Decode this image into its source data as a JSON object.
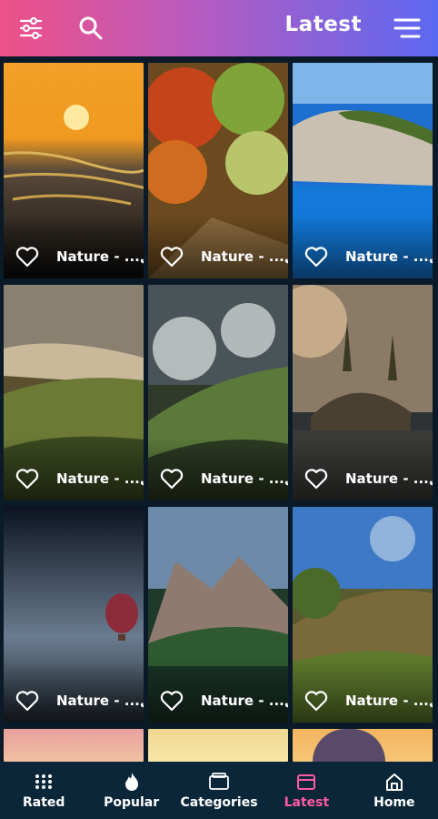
{
  "topbar": {
    "title": "Latest",
    "icons": [
      "filter-sliders-icon",
      "search-icon",
      "hamburger-menu-icon"
    ]
  },
  "wallpapers": [
    {
      "label": "Nature - ...ل",
      "scene": "sunset-river"
    },
    {
      "label": "Nature - ...ل",
      "scene": "autumn-forest"
    },
    {
      "label": "Nature - ...ل",
      "scene": "coastal-cliff"
    },
    {
      "label": "Nature - ...ل",
      "scene": "hill-valley"
    },
    {
      "label": "Nature - ...ل",
      "scene": "cloudy-mountain"
    },
    {
      "label": "Nature - ...ل",
      "scene": "pine-island"
    },
    {
      "label": "Nature - ...ل",
      "scene": "balloon-sky"
    },
    {
      "label": "Nature - ...ل",
      "scene": "alpine-lake"
    },
    {
      "label": "Nature - ...ل",
      "scene": "green-valley"
    }
  ],
  "bottom_nav": {
    "items": [
      {
        "label": "Rated",
        "icon": "dots-grid-icon"
      },
      {
        "label": "Popular",
        "icon": "flame-icon"
      },
      {
        "label": "Categories",
        "icon": "folder-icon"
      },
      {
        "label": "Latest",
        "icon": "calendar-icon"
      },
      {
        "label": "Home",
        "icon": "home-icon"
      }
    ],
    "active": "Latest",
    "active_color": "#ff5aa4"
  },
  "colors": {
    "header_gradient_start": "#ef5187",
    "header_gradient_end": "#5b69f2",
    "background": "#0a1a28",
    "nav_background": "#0b2639"
  }
}
